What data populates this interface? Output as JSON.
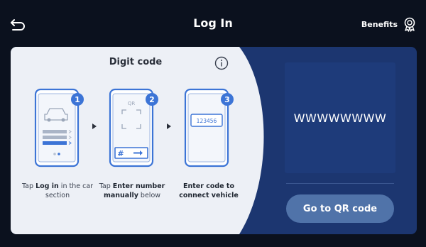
{
  "header": {
    "title": "Log In",
    "benefits_label": "Benefits",
    "back_icon": "back-arrow-icon",
    "benefits_icon": "award-icon"
  },
  "digit_code": {
    "section_title": "Digit code",
    "info_icon": "info-icon",
    "steps": [
      {
        "number": "1",
        "caption_pre": "Tap ",
        "caption_bold": "Log in",
        "caption_post": " in the car section",
        "illustration": "phone-car-login-icon"
      },
      {
        "number": "2",
        "caption_pre": "Tap ",
        "caption_bold": "Enter number manually",
        "caption_post": " below",
        "qr_label": "QR",
        "hash_label": "#",
        "illustration": "phone-qr-scan-icon"
      },
      {
        "number": "3",
        "caption_pre": "",
        "caption_bold": "Enter code to connect vehicle",
        "caption_post": "",
        "sample_code": "123456",
        "illustration": "phone-code-entry-icon"
      }
    ]
  },
  "code_panel": {
    "code": "WWWWWWWW",
    "qr_button_label": "Go to QR code"
  },
  "colors": {
    "background": "#0b111e",
    "card_blue": "#1c3670",
    "card_light": "#edf0f6",
    "accent": "#3c74d6",
    "button": "#5073a9"
  }
}
